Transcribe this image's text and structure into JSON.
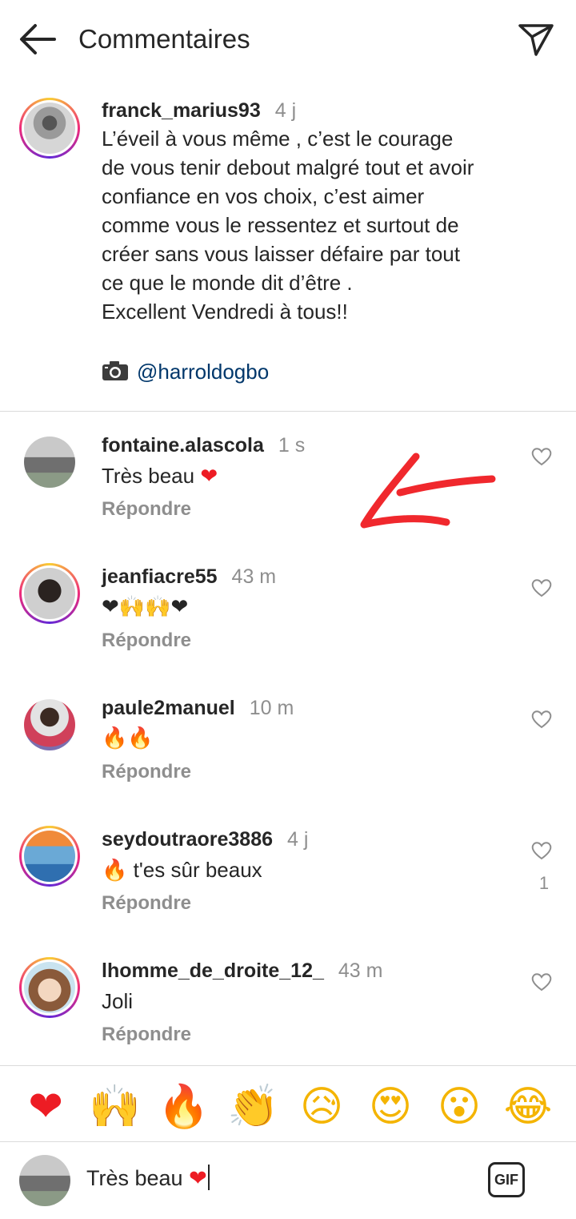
{
  "header": {
    "title": "Commentaires"
  },
  "caption": {
    "username": "franck_marius93",
    "time": "4 j",
    "text": "L’éveil à vous même , c’est le courage\nde vous tenir debout malgré tout et avoir\nconfiance en vos choix, c’est aimer\ncomme vous le ressentez et surtout de\ncréer sans vous laisser défaire par tout\nce que le monde dit d’être .\nExcellent Vendredi à tous!!",
    "camera_icon": "camera-icon",
    "mention": "@harroldogbo"
  },
  "comments": [
    {
      "username": "fontaine.alascola",
      "time": "1 s",
      "text": "Très beau",
      "emoji": "❤",
      "reply": "Répondre"
    },
    {
      "username": "jeanfiacre55",
      "time": "43 m",
      "emoji": "❤🙌🙌❤",
      "reply": "Répondre"
    },
    {
      "username": "paule2manuel",
      "time": "10 m",
      "emoji": "🔥🔥",
      "reply": "Répondre"
    },
    {
      "username": "seydoutraore3886",
      "time": "4 j",
      "emoji": "🔥",
      "text": "t'es sûr beaux",
      "reply": "Répondre",
      "likes": "1"
    },
    {
      "username": "lhomme_de_droite_12_",
      "time": "43 m",
      "text": "Joli",
      "reply": "Répondre"
    }
  ],
  "emoji_bar": [
    "❤",
    "🙌",
    "🔥",
    "👏",
    "😥",
    "😍",
    "😮",
    "😂"
  ],
  "input": {
    "value": "Très beau",
    "emoji": "❤",
    "gif_label": "GIF"
  },
  "colors": {
    "text": "#262626",
    "secondary": "#8e8e8e",
    "link": "#00376b",
    "annotation": "#f0282d"
  }
}
